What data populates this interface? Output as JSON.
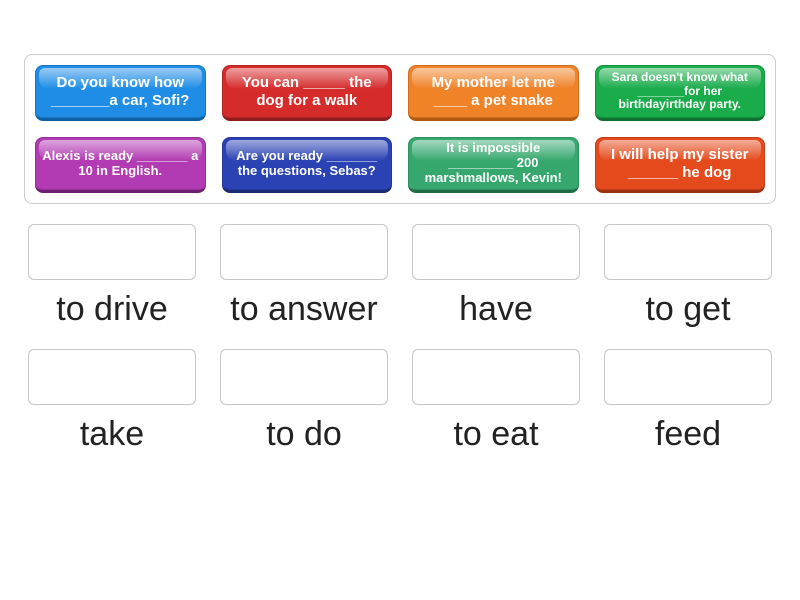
{
  "tiles": [
    {
      "text": "Do you know how _______a car, Sofi?",
      "color": "c-blue",
      "size": "fs15"
    },
    {
      "text": "You can _____ the dog for a walk",
      "color": "c-red",
      "size": "fs15"
    },
    {
      "text": "My mother let me ____ a pet snake",
      "color": "c-orange",
      "size": "fs15"
    },
    {
      "text": "Sara doesn't know what _______for her birthdayirthday party.",
      "color": "c-green",
      "size": "fs12"
    },
    {
      "text": "Alexis is ready _______ a 10 in English.",
      "color": "c-magenta",
      "size": "fs13"
    },
    {
      "text": "Are you ready _______ the questions, Sebas?",
      "color": "c-dblue",
      "size": "fs13"
    },
    {
      "text": "It is impossible _________ 200 marshmallows, Kevin!",
      "color": "c-sgreen",
      "size": "fs13"
    },
    {
      "text": "I will help my sister ______ he dog",
      "color": "c-ored",
      "size": "fs15"
    }
  ],
  "answers": [
    {
      "label": "to drive"
    },
    {
      "label": "to answer"
    },
    {
      "label": "have"
    },
    {
      "label": "to get"
    },
    {
      "label": "take"
    },
    {
      "label": "to do"
    },
    {
      "label": "to eat"
    },
    {
      "label": "feed"
    }
  ]
}
